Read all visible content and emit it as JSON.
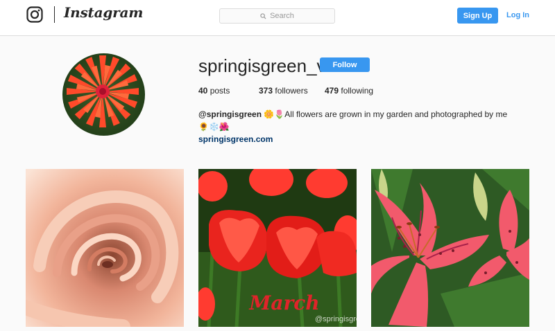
{
  "header": {
    "brand": "Instagram",
    "search_placeholder": "Search",
    "signup_label": "Sign Up",
    "login_label": "Log In",
    "accent": "#3897f0"
  },
  "profile": {
    "username": "springisgreen_v",
    "follow_label": "Follow",
    "posts_count": "40",
    "posts_label": "posts",
    "followers_count": "373",
    "followers_label": "followers",
    "following_count": "479",
    "following_label": "following",
    "bio_handle": "@springisgreen",
    "bio_emoji_1": "🌼🌷",
    "bio_text": "All flowers are grown in my garden and photographed by me",
    "bio_emoji_2": "🌻❄️🌺",
    "website": "springisgreen.com"
  },
  "posts": [
    {
      "subject": "peach rose"
    },
    {
      "subject": "red tulips",
      "overlay_text": "March",
      "watermark": "@springisgreen"
    },
    {
      "subject": "pink lilies"
    }
  ],
  "icons": [
    "instagram-icon",
    "search-icon"
  ]
}
